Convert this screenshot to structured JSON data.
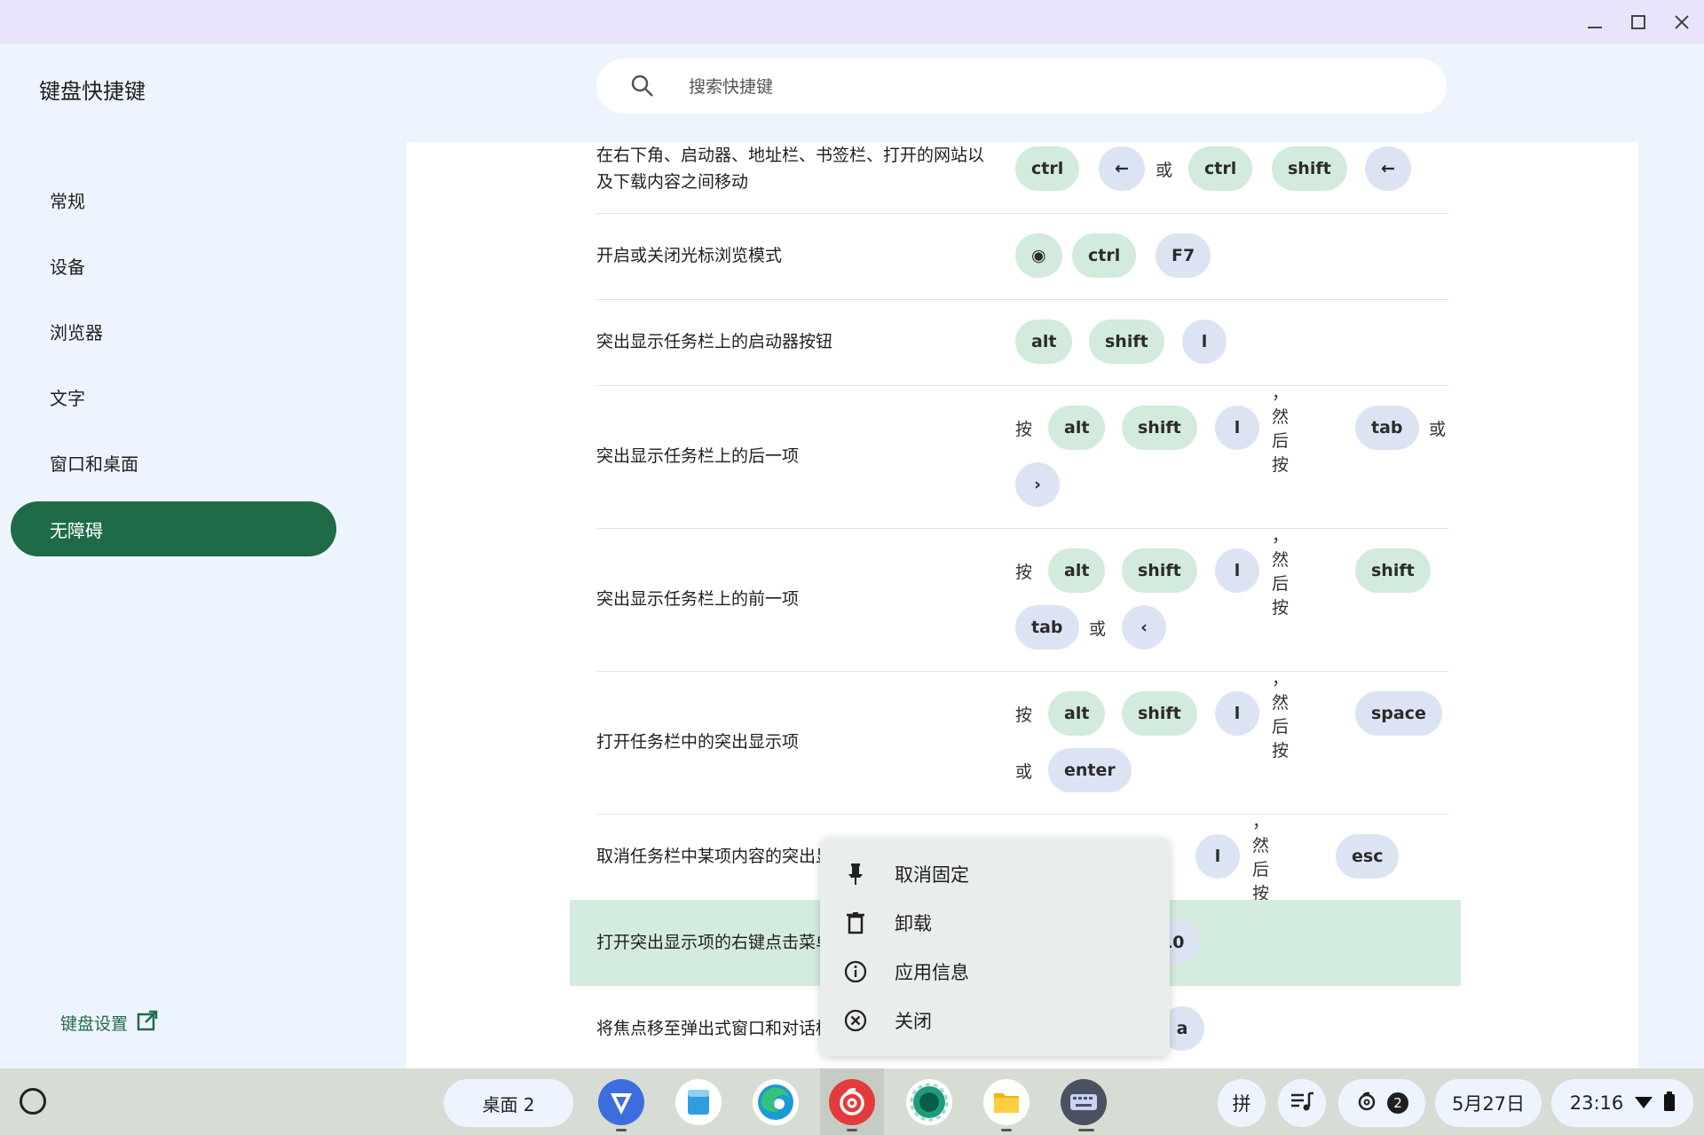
{
  "window": {
    "minimize_icon": "minimize-icon",
    "maximize_icon": "maximize-icon",
    "close_icon": "close-icon"
  },
  "app_title": "键盘快捷键",
  "search": {
    "placeholder": "搜索快捷键",
    "icon": "search-icon"
  },
  "nav": {
    "items": [
      {
        "label": "常规"
      },
      {
        "label": "设备"
      },
      {
        "label": "浏览器"
      },
      {
        "label": "文字"
      },
      {
        "label": "窗口和桌面"
      },
      {
        "label": "无障碍",
        "active": true
      }
    ],
    "keyboard_settings": "键盘设置"
  },
  "shortcuts": [
    {
      "desc": "在右下角、启动器、地址栏、书签栏、打开的网站以及下载内容之间移动",
      "line1": [
        {
          "k": "ctrl",
          "t": "mod"
        },
        {
          "k": "←",
          "t": "reg"
        },
        {
          "x": "或"
        },
        {
          "k": "ctrl",
          "t": "mod"
        },
        {
          "k": "shift",
          "t": "mod"
        },
        {
          "k": "←",
          "t": "reg"
        }
      ]
    },
    {
      "desc": "开启或关闭光标浏览模式",
      "line1": [
        {
          "k": "◉",
          "t": "mod"
        },
        {
          "k": "ctrl",
          "t": "mod"
        },
        {
          "k": "F7",
          "t": "reg"
        }
      ]
    },
    {
      "desc": "突出显示任务栏上的启动器按钮",
      "line1": [
        {
          "k": "alt",
          "t": "mod"
        },
        {
          "k": "shift",
          "t": "mod"
        },
        {
          "k": "l",
          "t": "reg"
        }
      ]
    },
    {
      "desc": "突出显示任务栏上的后一项",
      "line1": [
        {
          "x": "按"
        },
        {
          "k": "alt",
          "t": "mod"
        },
        {
          "k": "shift",
          "t": "mod"
        },
        {
          "k": "l",
          "t": "reg"
        },
        {
          "x": "，然后按"
        },
        {
          "k": "tab",
          "t": "reg"
        },
        {
          "x": "或"
        }
      ],
      "line2": [
        {
          "k": "›",
          "t": "reg"
        }
      ]
    },
    {
      "desc": "突出显示任务栏上的前一项",
      "line1": [
        {
          "x": "按"
        },
        {
          "k": "alt",
          "t": "mod"
        },
        {
          "k": "shift",
          "t": "mod"
        },
        {
          "k": "l",
          "t": "reg"
        },
        {
          "x": "，然后按"
        },
        {
          "k": "shift",
          "t": "mod"
        }
      ],
      "line2": [
        {
          "k": "tab",
          "t": "reg"
        },
        {
          "x": "或"
        },
        {
          "k": "‹",
          "t": "reg"
        }
      ]
    },
    {
      "desc": "打开任务栏中的突出显示项",
      "line1": [
        {
          "x": "按"
        },
        {
          "k": "alt",
          "t": "mod"
        },
        {
          "k": "shift",
          "t": "mod"
        },
        {
          "k": "l",
          "t": "reg"
        },
        {
          "x": "，然后按"
        },
        {
          "k": "space",
          "t": "reg"
        }
      ],
      "line2": [
        {
          "x": "或"
        },
        {
          "k": "enter",
          "t": "reg"
        }
      ]
    },
    {
      "desc": "取消任务栏中某项内容的突出显示",
      "line1": [
        {
          "k": "l",
          "t": "reg"
        },
        {
          "x": "，然后按"
        },
        {
          "k": "esc",
          "t": "reg"
        }
      ]
    },
    {
      "desc": "打开突出显示项的右键点击菜单",
      "line1": [
        {
          "k": "F10",
          "t": "reg"
        }
      ]
    },
    {
      "desc": "将焦点移至弹出式窗口和对话框",
      "line1": [
        {
          "k": "a",
          "t": "reg"
        }
      ]
    }
  ],
  "context_menu": {
    "items": [
      {
        "label": "取消固定",
        "icon": "pin-icon"
      },
      {
        "label": "卸载",
        "icon": "trash-icon"
      },
      {
        "label": "应用信息",
        "icon": "info-icon"
      },
      {
        "label": "关闭",
        "icon": "close-circle-icon"
      }
    ]
  },
  "shelf": {
    "desk_label": "桌面 2",
    "apps": [
      {
        "name": "arrow-app-icon",
        "color": "#3d6ee0"
      },
      {
        "name": "notes-app-icon",
        "color": "#2f9de0"
      },
      {
        "name": "edge-browser-icon",
        "color": "#1b9ad6"
      },
      {
        "name": "netease-music-icon",
        "color": "#e33b3b"
      },
      {
        "name": "camera-app-icon",
        "color": "#1f9c7d"
      },
      {
        "name": "files-app-icon",
        "color": "#f4b400"
      },
      {
        "name": "keyboard-shortcuts-icon",
        "color": "#4a5160"
      }
    ],
    "ime": "拼",
    "notification_count": "2",
    "date": "5月27日",
    "time": "23:16"
  }
}
